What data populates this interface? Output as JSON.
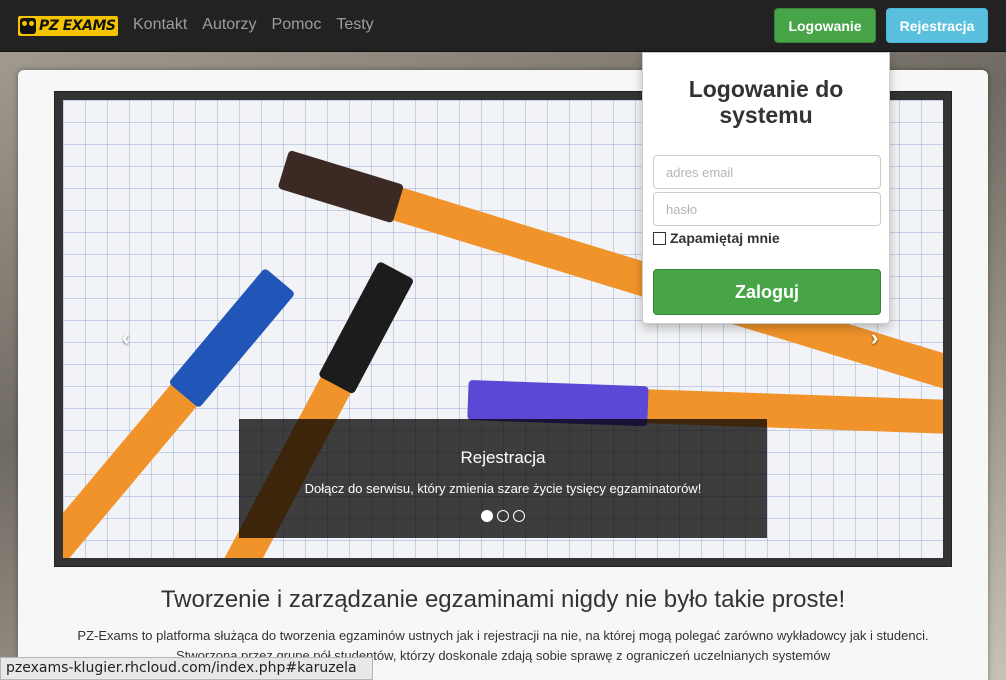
{
  "brand": {
    "text": "PZ EXAMS"
  },
  "nav": {
    "links": [
      "Kontakt",
      "Autorzy",
      "Pomoc",
      "Testy"
    ]
  },
  "top_buttons": {
    "login": "Logowanie",
    "register": "Rejestracja"
  },
  "login_panel": {
    "title": "Logowanie do systemu",
    "email_placeholder": "adres email",
    "password_placeholder": "hasło",
    "remember_label": "Zapamiętaj mnie",
    "submit": "Zaloguj"
  },
  "carousel": {
    "caption_title": "Rejestracja",
    "caption_text": "Dołącz do serwisu, który zmienia szare życie tysięcy egzaminatorów!",
    "prev_glyph": "‹",
    "next_glyph": "›",
    "slides_count": 3,
    "active_index": 0
  },
  "main": {
    "headline": "Tworzenie i zarządzanie egzaminami nigdy nie było takie proste!",
    "lead": "PZ-Exams to platforma służąca do tworzenia egzaminów ustnych jak i rejestracji na nie, na której mogą polegać zarówno wykładowcy jak i studenci. Stworzona przez grupę pół studentów, którzy doskonale zdają sobie sprawę z ograniczeń uczelnianych systemów"
  },
  "status_bar": {
    "url": "pzexams-klugier.rhcloud.com/index.php#karuzela"
  },
  "colors": {
    "navbar": "#222222",
    "success": "#47a447",
    "info": "#5bc0de",
    "brand": "#f5c400"
  }
}
